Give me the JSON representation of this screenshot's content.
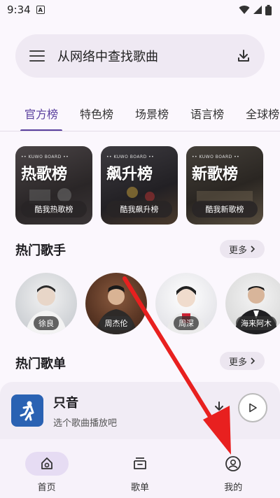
{
  "status_bar": {
    "time": "9:34",
    "notification_icons": [
      "a-icon"
    ],
    "system_icons": [
      "wifi-icon",
      "signal-icon",
      "battery-icon"
    ]
  },
  "search": {
    "placeholder": "从网络中查找歌曲",
    "menu_icon": "menu-icon",
    "action_icon": "download-icon"
  },
  "tabs": [
    {
      "label": "官方榜",
      "active": true
    },
    {
      "label": "特色榜",
      "active": false
    },
    {
      "label": "场景榜",
      "active": false
    },
    {
      "label": "语言榜",
      "active": false
    },
    {
      "label": "全球榜",
      "active": false
    }
  ],
  "charts": [
    {
      "brand": "•• KUWO BOARD ••",
      "title": "热歌榜",
      "button": "酷我热歌榜"
    },
    {
      "brand": "•• KUWO BOARD ••",
      "title": "飙升榜",
      "button": "酷我飙升榜"
    },
    {
      "brand": "•• KUWO BOARD ••",
      "title": "新歌榜",
      "button": "酷我新歌榜"
    }
  ],
  "hot_singers": {
    "title": "热门歌手",
    "more": "更多",
    "items": [
      {
        "name": "徐良"
      },
      {
        "name": "周杰伦"
      },
      {
        "name": "周深"
      },
      {
        "name": "海来阿木"
      }
    ]
  },
  "hot_playlists": {
    "title": "热门歌单",
    "more": "更多"
  },
  "player": {
    "song": "只音",
    "hint": "选个歌曲播放吧"
  },
  "bottom_nav": [
    {
      "label": "首页",
      "icon": "home-icon",
      "active": true
    },
    {
      "label": "歌单",
      "icon": "playlist-icon",
      "active": false
    },
    {
      "label": "我的",
      "icon": "profile-icon",
      "active": false
    }
  ],
  "colors": {
    "accent": "#5a3f9e",
    "annotation_arrow": "#e8201f"
  }
}
